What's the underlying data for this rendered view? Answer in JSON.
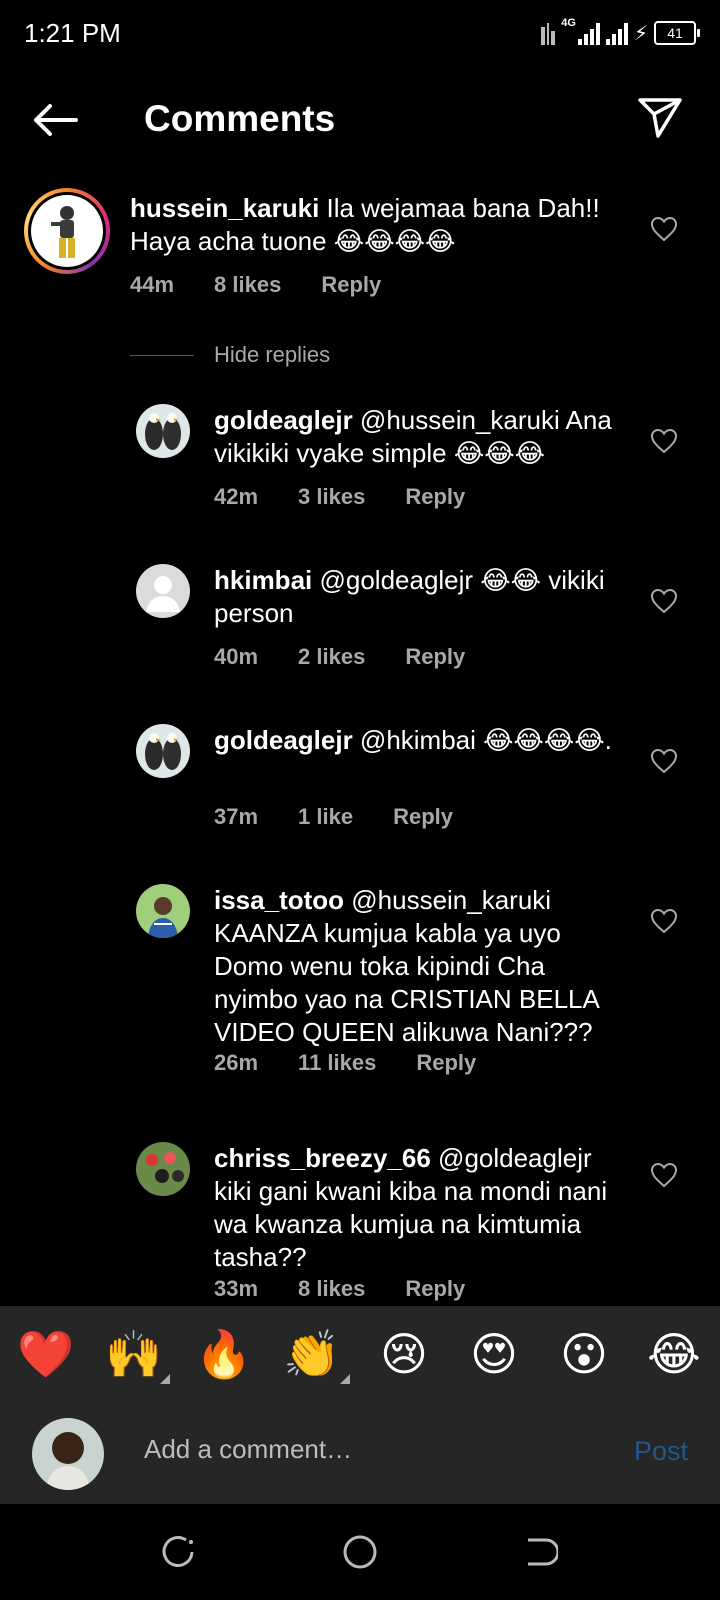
{
  "status_bar": {
    "time": "1:21 PM",
    "network": "4G",
    "battery": "41"
  },
  "header": {
    "title": "Comments"
  },
  "hide_replies_label": "Hide replies",
  "comments": [
    {
      "username": "hussein_karuki",
      "text": " Ila wejamaa bana Dah!! Haya acha tuone 😂😂😂😂",
      "time": "44m",
      "likes": "8 likes",
      "reply": "Reply"
    },
    {
      "username": "goldeaglejr",
      "text": " @hussein_karuki Ana vikikiki vyake simple 😂😂😂",
      "time": "42m",
      "likes": "3 likes",
      "reply": "Reply"
    },
    {
      "username": "hkimbai",
      "text": " @goldeaglejr 😂😂 vikiki person",
      "time": "40m",
      "likes": "2 likes",
      "reply": "Reply"
    },
    {
      "username": "goldeaglejr",
      "text": " @hkimbai 😂😂😂😂.",
      "time": "37m",
      "likes": "1 like",
      "reply": "Reply"
    },
    {
      "username": "issa_totoo",
      "text": " @hussein_karuki KAANZA kumjua kabla ya uyo Domo wenu toka kipindi Cha nyimbo yao na CRISTIAN BELLA VIDEO QUEEN alikuwa Nani???",
      "time": "26m",
      "likes": "11 likes",
      "reply": "Reply"
    },
    {
      "username": "chriss_breezy_66",
      "text": " @goldeaglejr kiki gani kwani kiba na mondi nani wa kwanza kumjua na kimtumia tasha??",
      "time": "33m",
      "likes": "8 likes",
      "reply": "Reply"
    }
  ],
  "emoji_bar": [
    "❤️",
    "🙌",
    "🔥",
    "👏",
    "😢",
    "😍",
    "😮",
    "😂"
  ],
  "composer": {
    "placeholder": "Add a comment…",
    "post_label": "Post"
  },
  "colors": {
    "background": "#000000",
    "panel": "#262626",
    "muted_text": "#a8a8a8",
    "post_disabled": "#1e5a8c"
  }
}
